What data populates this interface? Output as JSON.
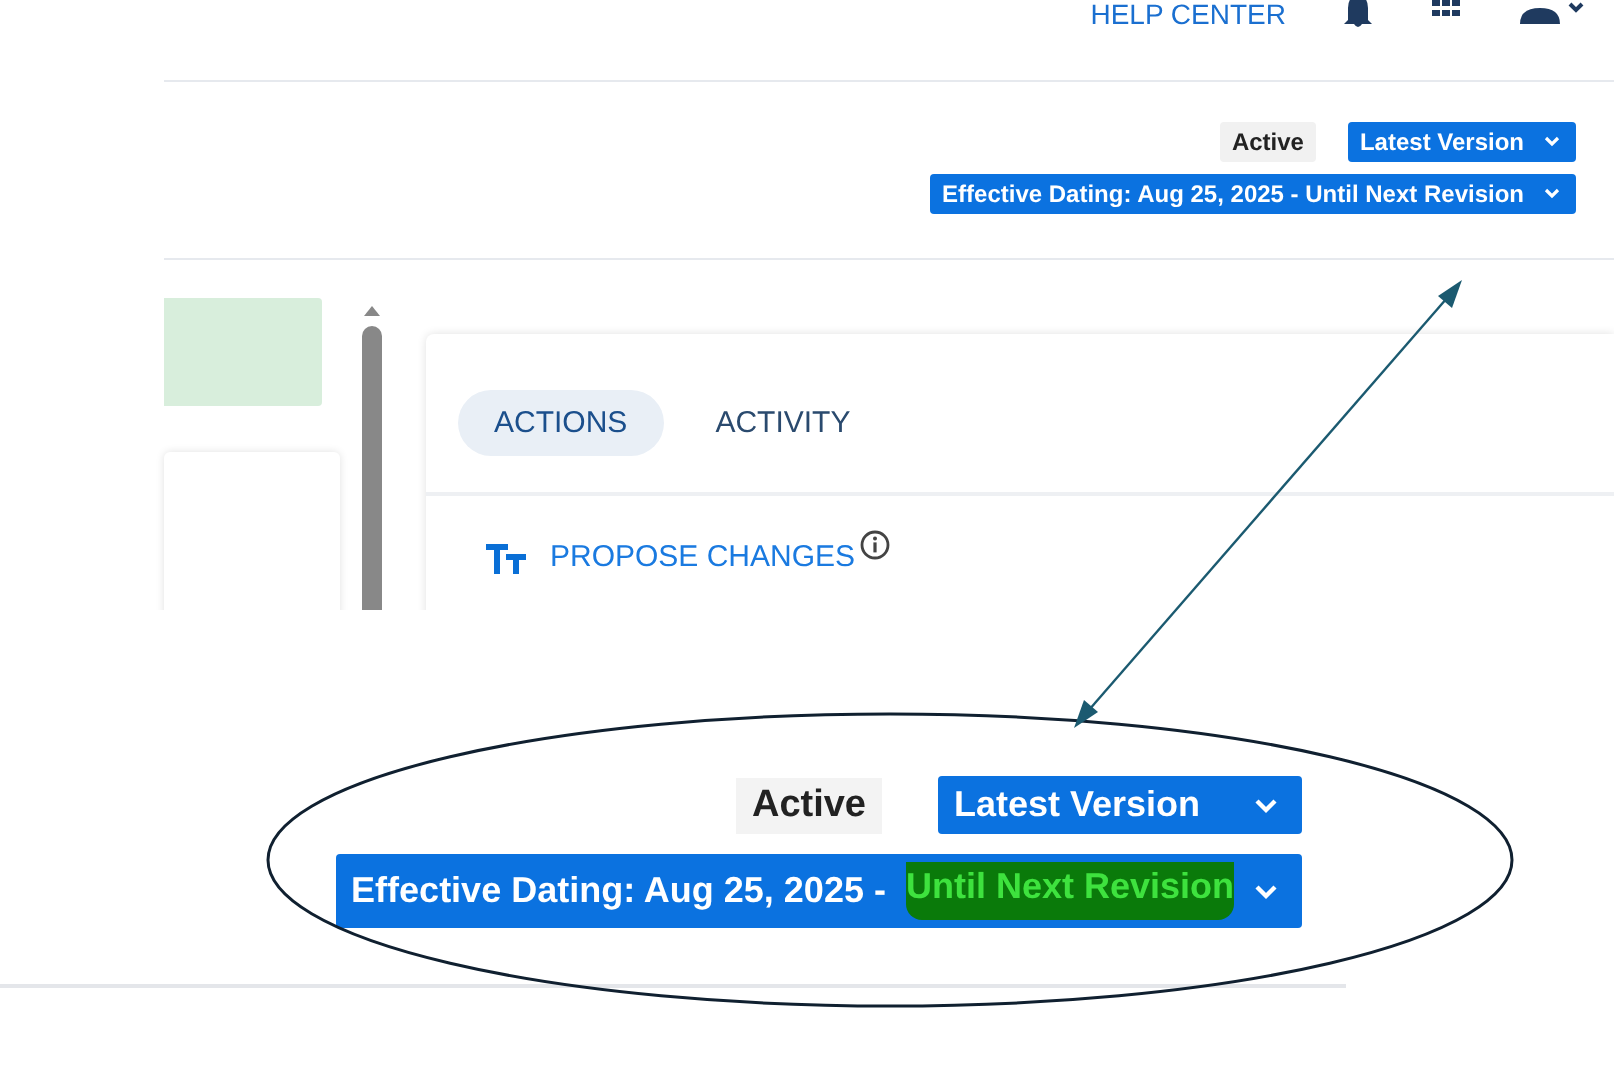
{
  "header": {
    "help_link": "HELP CENTER"
  },
  "status": {
    "badge": "Active",
    "version_dropdown": "Latest Version",
    "dating_dropdown": "Effective Dating: Aug 25, 2025 - Until Next Revision"
  },
  "panel": {
    "tabs": [
      {
        "label": "ACTIONS",
        "selected": true
      },
      {
        "label": "ACTIVITY",
        "selected": false
      }
    ],
    "actions": [
      {
        "label": "PROPOSE CHANGES"
      }
    ]
  },
  "zoom_inset": {
    "badge": "Active",
    "version_dropdown": "Latest Version",
    "dating_prefix": "Effective Dating: Aug 25, 2025 - ",
    "dating_highlighted": "Until Next Revision"
  }
}
